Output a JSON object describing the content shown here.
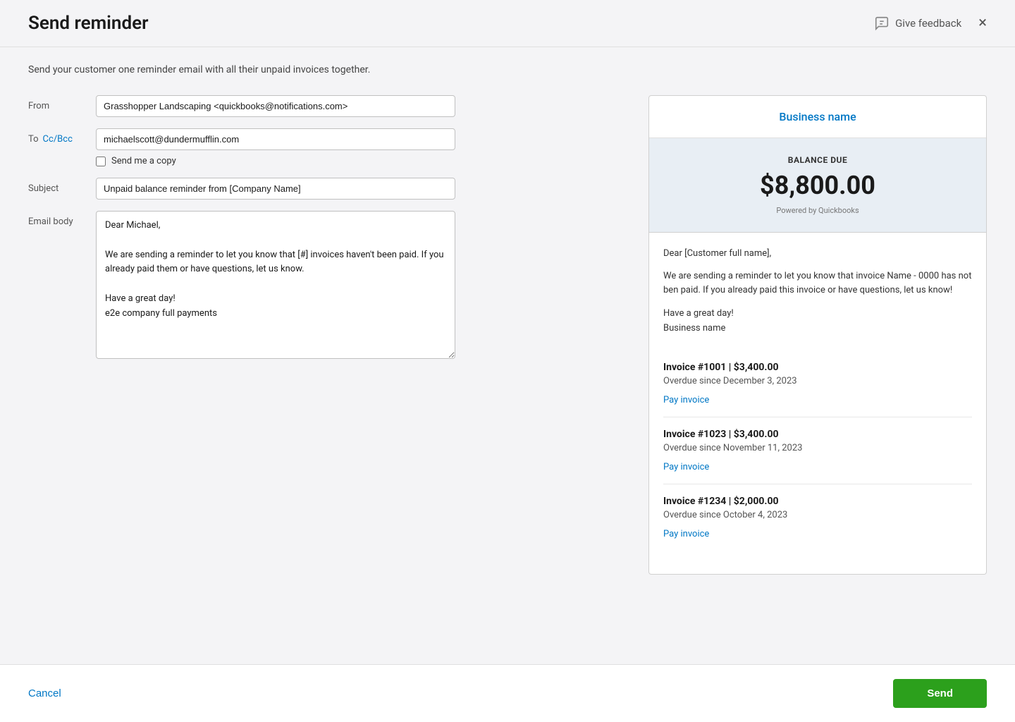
{
  "header": {
    "title": "Send reminder",
    "give_feedback_label": "Give feedback",
    "close_label": "×"
  },
  "subtitle": {
    "text": "Send your customer one reminder email with all their unpaid invoices together."
  },
  "form": {
    "from_label": "From",
    "from_value": "Grasshopper Landscaping <quickbooks@notifications.com>",
    "to_label": "To",
    "cc_bcc_label": "Cc/Bcc",
    "to_value": "michaelscott@dundermufflin.com",
    "send_me_copy_label": "Send me a copy",
    "subject_label": "Subject",
    "subject_value": "Unpaid balance reminder from [Company Name]",
    "email_body_label": "Email body",
    "email_body_value": "Dear Michael,\n\nWe are sending a reminder to let you know that [#] invoices haven't been paid. If you already paid them or have questions, let us know.\n\nHave a great day!\ne2e company full payments"
  },
  "preview": {
    "business_name": "Business name",
    "balance_due_label": "BALANCE DUE",
    "balance_amount": "$8,800.00",
    "powered_by": "Powered by Quickbooks",
    "greeting": "Dear [Customer full name],",
    "message": "We are sending a reminder to let you know that invoice Name - 0000 has not ben paid. If you already paid this invoice or have questions, let us know!",
    "sign_off_line1": "Have a great day!",
    "sign_off_line2": "Business name",
    "invoices": [
      {
        "title": "Invoice #1001 | $3,400.00",
        "overdue": "Overdue since December 3, 2023",
        "pay_link": "Pay invoice"
      },
      {
        "title": "Invoice #1023 | $3,400.00",
        "overdue": "Overdue since November 11, 2023",
        "pay_link": "Pay invoice"
      },
      {
        "title": "Invoice #1234 | $2,000.00",
        "overdue": "Overdue since October 4, 2023",
        "pay_link": "Pay invoice"
      }
    ]
  },
  "footer": {
    "cancel_label": "Cancel",
    "send_label": "Send"
  }
}
